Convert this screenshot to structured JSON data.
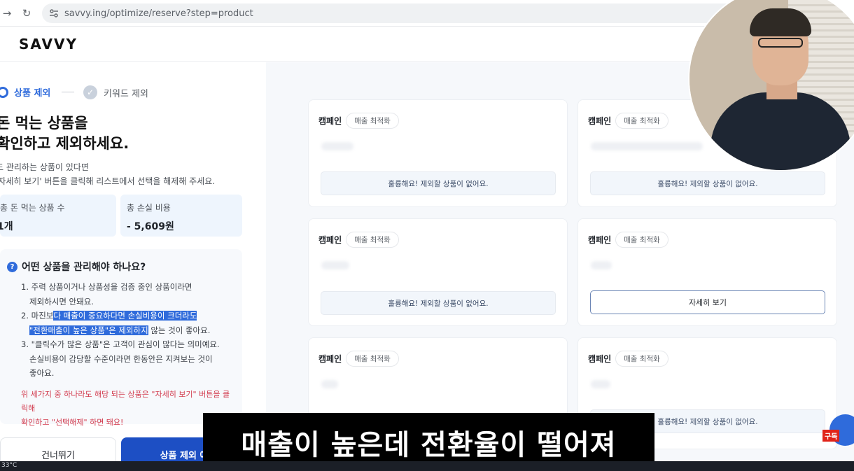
{
  "browser": {
    "url": "savvy.ing/optimize/reserve?step=product"
  },
  "header": {
    "logo": "SAVVY"
  },
  "steps": {
    "step1_label": "상품 제외",
    "step2_label": "키워드 제외"
  },
  "intro": {
    "headline_line1": "돈 먹는 상품을",
    "headline_line2": "확인하고 제외하세요.",
    "desc_line1": "도 관리하는 상품이 있다면",
    "desc_line2": "'자세히 보기' 버튼을 클릭해 리스트에서 선택을 해제해 주세요."
  },
  "stats": {
    "count_label": "총 돈 먹는 상품 수",
    "count_value": "1개",
    "loss_label": "총 손실 비용",
    "loss_value": "- 5,609원"
  },
  "guide": {
    "title": "어떤 상품을 관리해야 하나요?",
    "item1_a": "1. 주력 상품이거나 상품성을 검증 중인 상품이라면",
    "item1_b": "제외하시면 안돼요.",
    "item2_a_plain": "2. 마진보",
    "item2_a_hl": "다 매출이 중요하다면 손실비용이 크더라도",
    "item2_b_hl": "\"전환매출이 높은 상품\"은 제외하지",
    "item2_b_plain": " 않는 것이 좋아요.",
    "item3_a": "3. \"클릭수가 많은 상품\"은 고객이 관심이 많다는 의미예요.",
    "item3_b": "손실비용이 감당할 수준이라면 한동안은 지켜보는 것이",
    "item3_c": "좋아요.",
    "warn_line1": "위 세가지 중 하나라도 해당 되는 상품은 \"자세히 보기\" 버튼을 클릭해",
    "warn_line2": "확인하고 \"선택해제\" 하면 돼요!"
  },
  "actions": {
    "skip_label": "건너뛰기",
    "exclude_label": "상품 제외 예"
  },
  "cards": [
    {
      "label": "캠페인",
      "tag": "매출 최적화",
      "status": "훌륭해요! 제외할 상품이 없어요."
    },
    {
      "label": "캠페인",
      "tag": "매출 최적화",
      "status": "훌륭해요! 제외할 상품이 없어요."
    },
    {
      "label": "캠페인",
      "tag": "매출 최적화",
      "status": "훌륭해요! 제외할 상품이 없어요."
    },
    {
      "label": "캠페인",
      "tag": "매출 최적화",
      "status": "자세히 보기"
    },
    {
      "label": "캠페인",
      "tag": "매출 최적화",
      "status": ""
    },
    {
      "label": "캠페인",
      "tag": "매출 최적화",
      "status": "훌륭해요! 제외할 상품이 없어요."
    }
  ],
  "subtitle": "매출이 높은데 전환율이 떨어져",
  "subscribe": "구독",
  "taskbar": {
    "temp": "33°C"
  },
  "colors": {
    "primary": "#2f6bdb",
    "primary_dark": "#1d4fc4",
    "warn": "#d23b4e",
    "stat_bg": "#eef5fd"
  }
}
